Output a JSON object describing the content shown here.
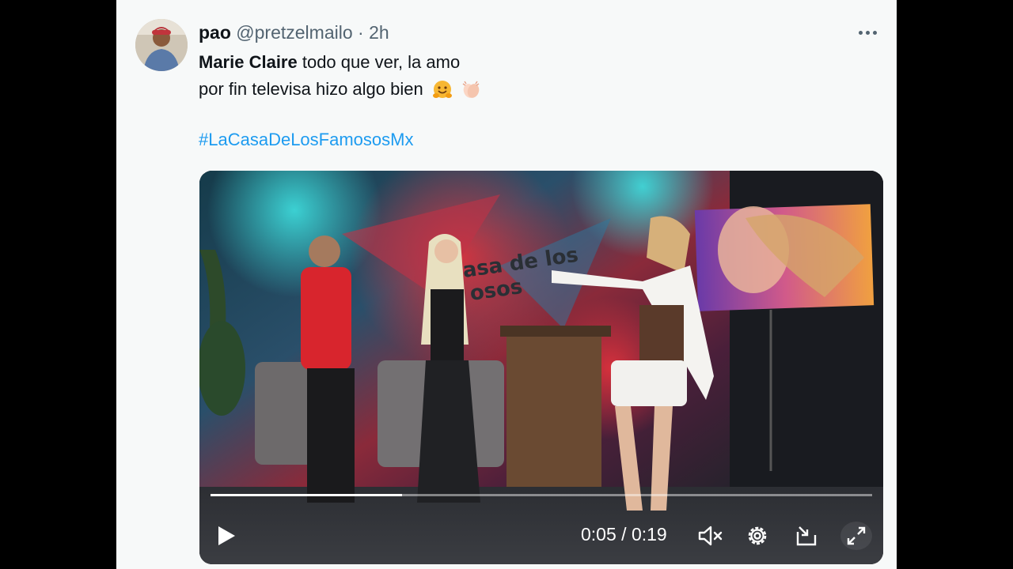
{
  "tweet": {
    "display_name": "pao",
    "handle": "@pretzelmailo",
    "separator": "·",
    "time_ago": "2h",
    "line1_bold": "Marie Claire",
    "line1_rest": " todo que ver, la amo",
    "line2": "por fin televisa hizo algo bien",
    "hashtag": "#LaCasaDeLosFamososMx"
  },
  "video": {
    "current_time": "0:05",
    "duration": "0:19",
    "time_sep": " / ",
    "progress": 0.29,
    "screen_text": "casa de los famosos méxico"
  },
  "icons": {
    "more": "more-horizontal-icon",
    "play": "play-icon",
    "mute": "volume-muted-icon",
    "settings": "gear-icon",
    "popout": "popout-icon",
    "fullscreen": "fullscreen-icon"
  },
  "colors": {
    "link": "#1d9bf0",
    "text": "#0f1419",
    "secondary": "#536471"
  }
}
